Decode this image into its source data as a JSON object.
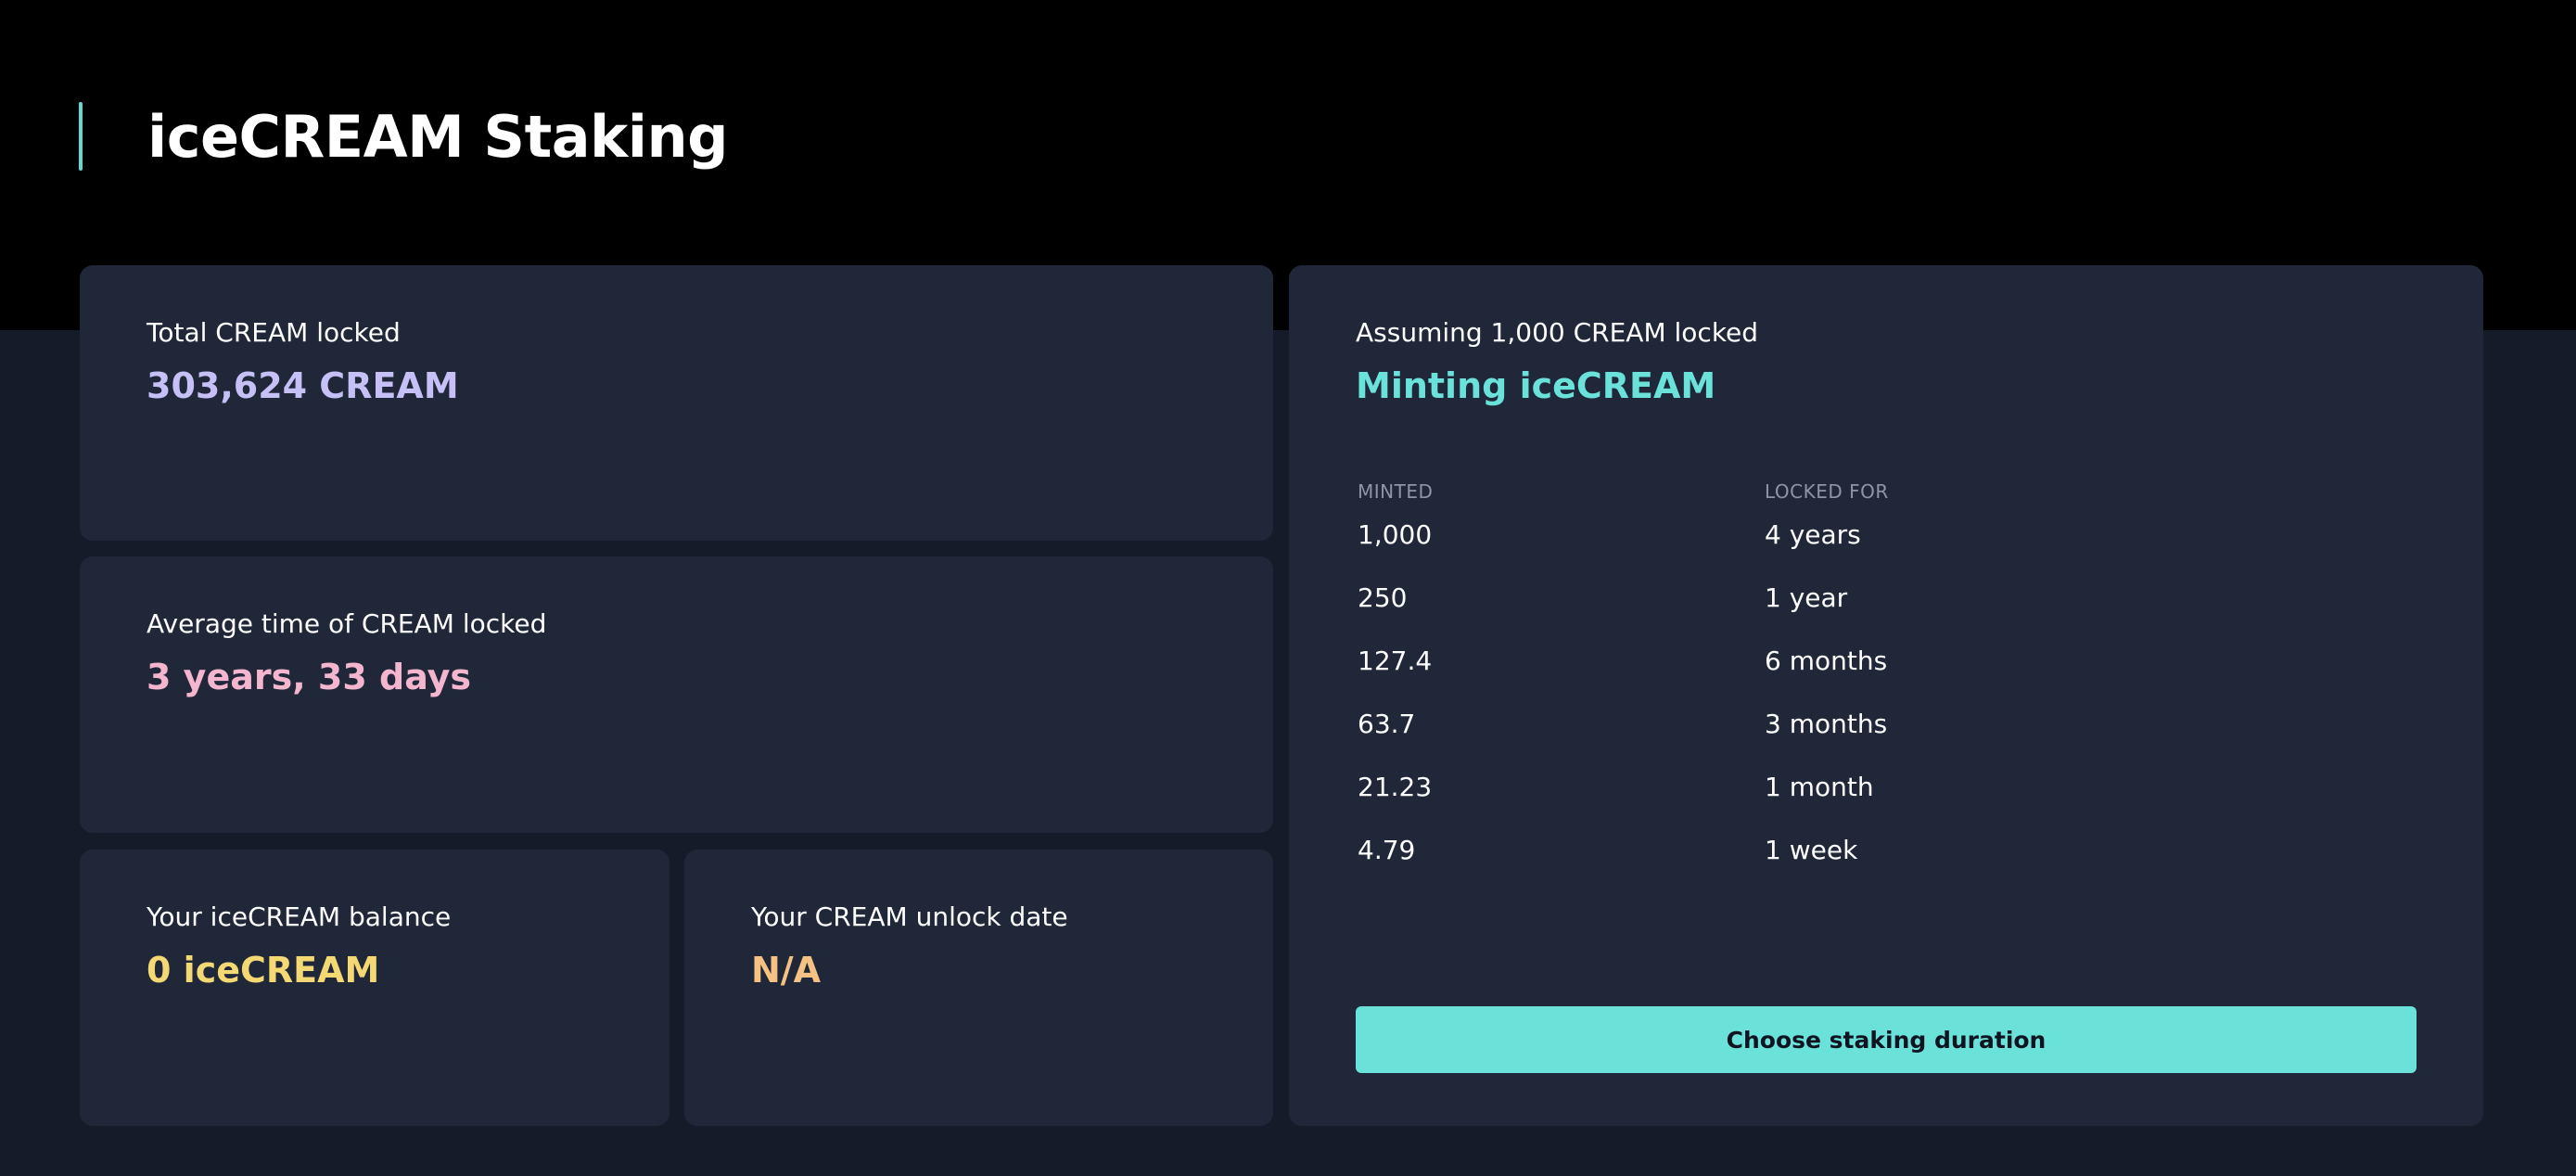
{
  "page": {
    "title": "iceCREAM Staking",
    "accent_color": "#5fd9d1"
  },
  "stats": {
    "total_locked": {
      "label": "Total CREAM locked",
      "value": "303,624 CREAM",
      "color": "#c6c0f7"
    },
    "average_time": {
      "label": "Average time of CREAM locked",
      "value": "3 years, 33 days",
      "color": "#f4b6cf"
    },
    "balance": {
      "label": "Your iceCREAM balance",
      "value": "0 iceCREAM",
      "color": "#f4d873"
    },
    "unlock_date": {
      "label": "Your CREAM unlock date",
      "value": "N/A",
      "color": "#f5c283"
    }
  },
  "minting": {
    "subtitle": "Assuming 1,000 CREAM locked",
    "title": "Minting iceCREAM",
    "title_color": "#6ae2da",
    "columns": [
      "MINTED",
      "LOCKED FOR"
    ],
    "rows": [
      {
        "minted": "1,000",
        "locked_for": "4 years"
      },
      {
        "minted": "250",
        "locked_for": "1 year"
      },
      {
        "minted": "127.4",
        "locked_for": "6 months"
      },
      {
        "minted": "63.7",
        "locked_for": "3 months"
      },
      {
        "minted": "21.23",
        "locked_for": "1 month"
      },
      {
        "minted": "4.79",
        "locked_for": "1 week"
      }
    ],
    "button_label": "Choose staking duration",
    "button_color": "#6ae2da"
  }
}
